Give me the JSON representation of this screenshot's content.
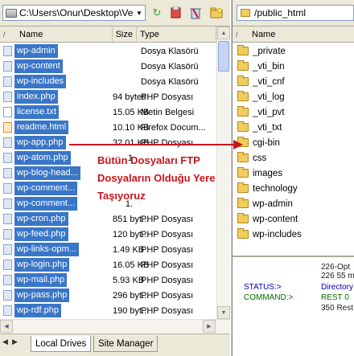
{
  "left": {
    "path": "C:\\Users\\Onur\\Desktop\\Ve",
    "columns": {
      "name": "Name",
      "size": "Size",
      "type": "Type"
    },
    "files": [
      {
        "name": "wp-admin",
        "size": "",
        "type": "Dosya Klasörü",
        "icon": "folder-file"
      },
      {
        "name": "wp-content",
        "size": "",
        "type": "Dosya Klasörü",
        "icon": "folder-file"
      },
      {
        "name": "wp-includes",
        "size": "",
        "type": "Dosya Klasörü",
        "icon": "folder-file"
      },
      {
        "name": "index.php",
        "size": "94 bytes",
        "type": "PHP Dosyası",
        "icon": "php-file"
      },
      {
        "name": "license.txt",
        "size": "15.05 KB",
        "type": "Metin Belgesi",
        "icon": "txt-file"
      },
      {
        "name": "readme.html",
        "size": "10.10 KB",
        "type": "Firefox Docum...",
        "icon": "html-file"
      },
      {
        "name": "wp-app.php",
        "size": "32.01 KB",
        "type": "PHP Dosyası",
        "icon": "php-file"
      },
      {
        "name": "wp-atom.php",
        "size": "1",
        "type": "",
        "icon": "php-file"
      },
      {
        "name": "wp-blog-head...",
        "size": "",
        "type": "",
        "icon": "php-file"
      },
      {
        "name": "wp-comment...",
        "size": "",
        "type": "",
        "icon": "php-file"
      },
      {
        "name": "wp-comment...",
        "size": "1.",
        "type": "",
        "icon": "php-file"
      },
      {
        "name": "wp-cron.php",
        "size": "851 byt...",
        "type": "PHP Dosyası",
        "icon": "php-file"
      },
      {
        "name": "wp-feed.php",
        "size": "120 byt...",
        "type": "PHP Dosyası",
        "icon": "php-file"
      },
      {
        "name": "wp-links-opm...",
        "size": "1.49 KB",
        "type": "PHP Dosyası",
        "icon": "php-file"
      },
      {
        "name": "wp-login.php",
        "size": "16.05 KB",
        "type": "PHP Dosyası",
        "icon": "php-file"
      },
      {
        "name": "wp-mail.php",
        "size": "5.93 KB",
        "type": "PHP Dosyası",
        "icon": "php-file"
      },
      {
        "name": "wp-pass.php",
        "size": "296 byt...",
        "type": "PHP Dosyası",
        "icon": "php-file"
      },
      {
        "name": "wp-rdf.php",
        "size": "190 byt...",
        "type": "PHP Dosyası",
        "icon": "php-file"
      }
    ],
    "tabs": [
      "Local Drives",
      "Site Manager"
    ]
  },
  "right": {
    "path": "/public_html",
    "columns": {
      "name": "Name"
    },
    "files": [
      {
        "name": "_private",
        "icon": "folder"
      },
      {
        "name": "_vti_bin",
        "icon": "folder"
      },
      {
        "name": "_vti_cnf",
        "icon": "folder"
      },
      {
        "name": "_vti_log",
        "icon": "folder"
      },
      {
        "name": "_vti_pvt",
        "icon": "folder"
      },
      {
        "name": "_vti_txt",
        "icon": "folder"
      },
      {
        "name": "cgi-bin",
        "icon": "folder"
      },
      {
        "name": "css",
        "icon": "folder"
      },
      {
        "name": "images",
        "icon": "folder"
      },
      {
        "name": "technology",
        "icon": "folder"
      },
      {
        "name": "wp-admin",
        "icon": "folder"
      },
      {
        "name": "wp-content",
        "icon": "folder"
      },
      {
        "name": "wp-includes",
        "icon": "folder"
      }
    ],
    "log": {
      "line1": "226-Opt",
      "line2": "226 55 m",
      "status_label": "STATUS:>",
      "status_value": "Directory",
      "command_label": "COMMAND:>",
      "command_value": "REST 0",
      "line5": "350 Rest"
    }
  },
  "annotation": {
    "line1": "Bütün Dosyaları FTP",
    "line2": "Dosyaların Olduğu Yere",
    "line3": "Taşıyoruz"
  },
  "colors": {
    "selection": "#3a76c8",
    "annotation": "#c8161d",
    "chrome": "#ece9d8"
  }
}
